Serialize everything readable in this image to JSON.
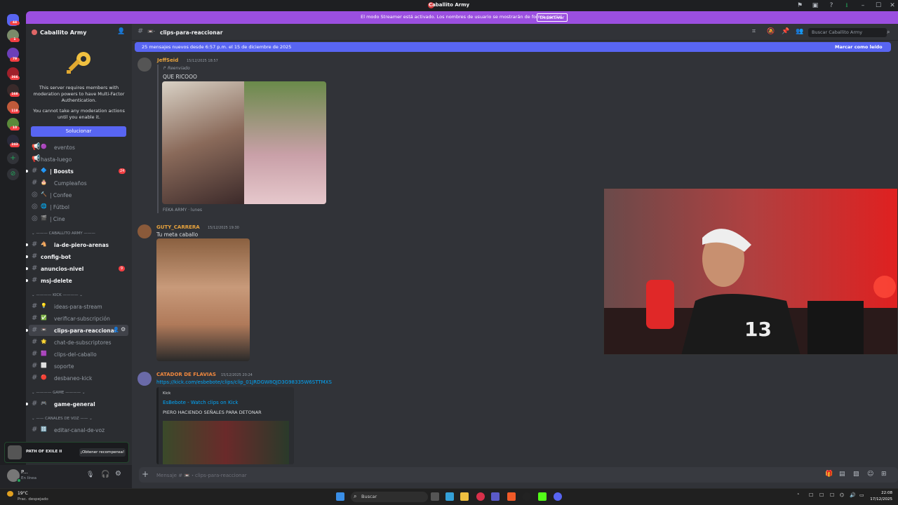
{
  "window": {
    "title": "Caballito Army"
  },
  "streamer_banner": {
    "text": "El modo Streamer está activado. Los nombres de usuario se mostrarán de forma parcial.",
    "button": "Desactivar"
  },
  "servers": {
    "badges": [
      "44",
      "1",
      "79",
      "366",
      "168",
      "118",
      "10",
      "243"
    ]
  },
  "sidebar": {
    "server_name": "Caballito Army",
    "mfa": {
      "text1": "This server requires members with moderation powers to have Multi-Factor Authentication.",
      "text2": "You cannot take any moderation actions until you enable it.",
      "button": "Solucionar"
    },
    "channels": [
      {
        "label": "eventos",
        "emoji": "🟣",
        "badge": ""
      },
      {
        "label": "hasta-luego",
        "emoji": "",
        "badge": ""
      },
      {
        "label": "| Boosts",
        "emoji": "🔷",
        "badge": "24"
      },
      {
        "label": "Cumpleaños",
        "emoji": "🎂",
        "badge": ""
      },
      {
        "label": "| Confee",
        "emoji": "🔨",
        "badge": ""
      },
      {
        "label": "| Fútbol",
        "emoji": "🌐",
        "badge": ""
      },
      {
        "label": "| Cine",
        "emoji": "🎬",
        "badge": ""
      }
    ],
    "cat_caballito": "CABALLITO ARMY",
    "channels2": [
      {
        "label": "ia-de-piero-arenas",
        "emoji": "🐴",
        "badge": ""
      },
      {
        "label": "config-bot",
        "emoji": "",
        "badge": ""
      },
      {
        "label": "anuncios-nivel",
        "emoji": "",
        "badge": "9"
      },
      {
        "label": "msj-delete",
        "emoji": "",
        "badge": ""
      }
    ],
    "cat_kick": "KICK",
    "channels3": [
      {
        "label": "ideas-para-stream",
        "emoji": "💡"
      },
      {
        "label": "verificar-subscripción",
        "emoji": "✅"
      },
      {
        "label": "clips-para-reaccionar",
        "emoji": "📼"
      },
      {
        "label": "chat-de-subscriptores",
        "emoji": "🌟"
      },
      {
        "label": "clips-del-caballo",
        "emoji": "🟪"
      },
      {
        "label": "soporte",
        "emoji": "⬜"
      },
      {
        "label": "desbaneo-kick",
        "emoji": "🔴"
      }
    ],
    "cat_game": "GAME",
    "channels4": [
      {
        "label": "game-general",
        "emoji": "🎮"
      }
    ],
    "cat_voz": "CANALES DE VOZ",
    "channels5": [
      {
        "label": "editar-canal-de-voz",
        "emoji": "🔠"
      }
    ],
    "promo": {
      "title": "PATH OF EXILE II",
      "button": "¡Obtener recompensa!"
    },
    "user": {
      "name": "P...",
      "status": "En línea"
    }
  },
  "main": {
    "channel": "clips-para-reaccionar",
    "search_placeholder": "Buscar Caballito Army",
    "new_messages": "25 mensajes nuevos desde 6:57 p.m. el 15 de diciembre de 2025",
    "mark_read": "Marcar como leído",
    "messages": [
      {
        "user": "JeffSeid",
        "time": "15/12/2025 18:57",
        "forwarded": "Reenviado",
        "text": "QUE RICOOO",
        "source": "FEKA ARMY · lunes",
        "color": "#e8a33d"
      },
      {
        "user": "GUTY_CARRERA",
        "time": "15/12/2025 19:30",
        "text": "Tu meta caballo",
        "color": "#e8a33d"
      },
      {
        "user": "CATADOR DE FLAVIAS",
        "time": "15/12/2025 20:24",
        "link": "https://kick.com/esbebote/clips/clip_01JRDGW8QJD3G98335W6STTMXS",
        "embed_provider": "Kick",
        "embed_title": "EsBebote - Watch clips on Kick",
        "embed_desc": "PIERO HACIENDO SEÑALES PARA DETONAR",
        "color": "#f0883e"
      }
    ],
    "composer_placeholder": "Mensaje # 📼・clips-para-reaccionar"
  },
  "taskbar": {
    "weather_temp": "19°C",
    "weather_desc": "Prac. despejado",
    "search": "Buscar",
    "time": "22:08",
    "date": "17/12/2025"
  }
}
